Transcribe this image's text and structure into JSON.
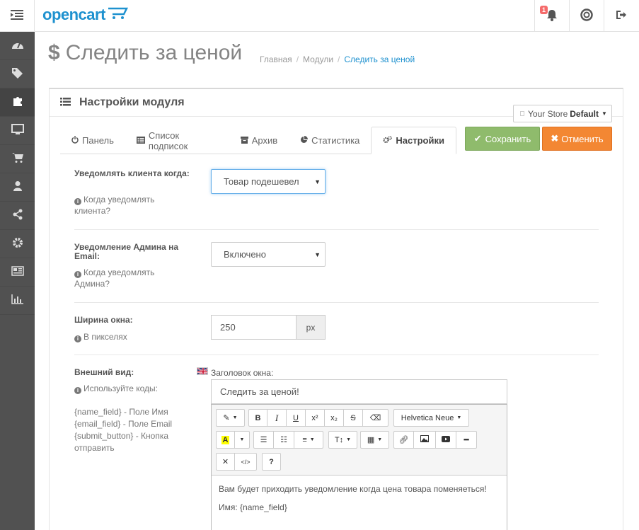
{
  "header": {
    "logo_text": "opencart",
    "notifications_count": "1",
    "icons": [
      "menu-toggle-icon",
      "bell-icon",
      "support-icon",
      "logout-icon"
    ]
  },
  "sidebar": {
    "items": [
      "dashboard-icon",
      "tags-icon",
      "puzzle-icon",
      "monitor-icon",
      "cart-icon",
      "user-icon",
      "share-icon",
      "gear-icon",
      "newspaper-icon",
      "bar-chart-icon"
    ],
    "active_index": 2
  },
  "page": {
    "title": "Следить за ценой",
    "breadcrumb": [
      {
        "label": "Главная"
      },
      {
        "label": "Модули"
      },
      {
        "label": "Следить за ценой"
      }
    ]
  },
  "panel": {
    "heading": "Настройки модуля",
    "store_label": "Your Store",
    "store_value": "Default",
    "save_label": "Сохранить",
    "cancel_label": "Отменить"
  },
  "tabs": [
    {
      "label": "Панель",
      "icon": "power-icon"
    },
    {
      "label": "Список подписок",
      "icon": "list-icon"
    },
    {
      "label": "Архив",
      "icon": "archive-icon"
    },
    {
      "label": "Статистика",
      "icon": "pie-chart-icon"
    },
    {
      "label": "Настройки",
      "icon": "cogs-icon",
      "active": true
    }
  ],
  "form": {
    "notify_client": {
      "label": "Уведомлять клиента когда:",
      "help": "Когда уведомлять клиента?",
      "value": "Товар подешевел"
    },
    "admin_email": {
      "label": "Уведомление Админа на Email:",
      "help": "Когда уведомлять Админа?",
      "value": "Включено"
    },
    "window_width": {
      "label": "Ширина окна:",
      "help": "В пикселях",
      "value": "250",
      "unit": "px"
    },
    "appearance": {
      "label": "Внешний вид:",
      "help": "Используйте коды:",
      "codes": [
        "{name_field} - Поле Имя",
        "{email_field} - Поле Email",
        "{submit_button} - Кнопка отправить"
      ],
      "window_title_label": "Заголовок окна:",
      "window_title_value": "Следить за ценой!"
    }
  },
  "editor": {
    "font_family": "Helvetica Neue",
    "body": [
      "Вам будет приходить уведомление когда цена товара поменяеться!",
      "Имя: {name_field}"
    ]
  }
}
